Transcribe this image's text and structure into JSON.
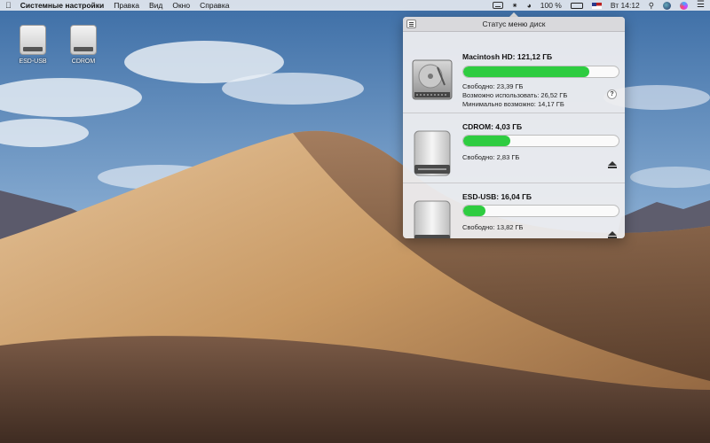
{
  "menubar": {
    "app_name": "Системные настройки",
    "menus": [
      "Правка",
      "Вид",
      "Окно",
      "Справка"
    ],
    "battery": "100 %",
    "clock": "Вт 14:12"
  },
  "desktop": {
    "icons": [
      {
        "label": "ESD-USB"
      },
      {
        "label": "CDROM"
      }
    ]
  },
  "panel": {
    "title": "Статус меню диск",
    "bar_color": "#2ecc40",
    "disks": [
      {
        "title": "Macintosh HD: 121,12 ГБ",
        "used_fraction": 0.81,
        "free": "Свободно: 23,39 ГБ",
        "available": "Возможно использовать: 26,52 ГБ",
        "minimum": "Минимально возможно: 14,17 ГБ",
        "icon": "internal-hard-drive-icon"
      },
      {
        "title": "CDROM: 4,03 ГБ",
        "used_fraction": 0.3,
        "free": "Свободно: 2,83 ГБ",
        "icon": "external-drive-icon"
      },
      {
        "title": "ESD-USB: 16,04 ГБ",
        "used_fraction": 0.14,
        "free": "Свободно: 13,82 ГБ",
        "icon": "external-drive-icon"
      }
    ]
  }
}
